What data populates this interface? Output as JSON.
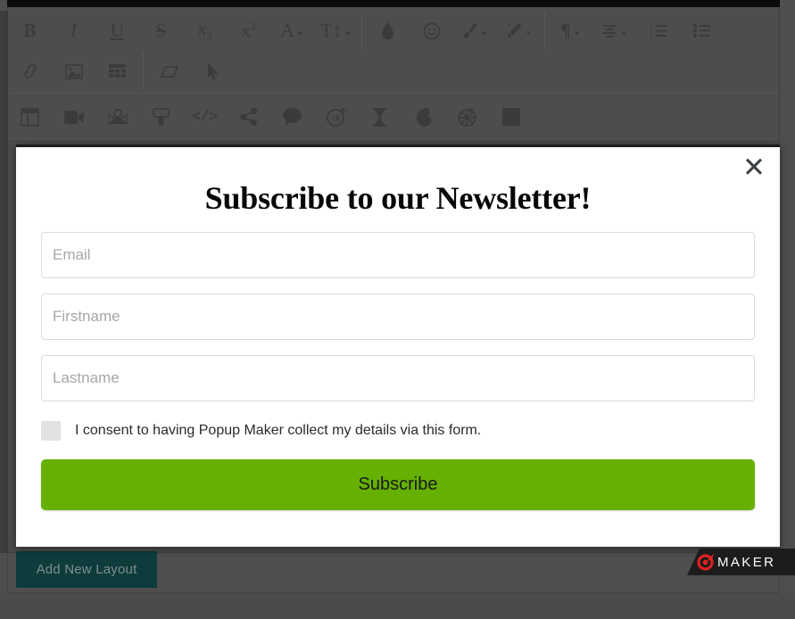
{
  "editor": {
    "toolbar_row1": [
      {
        "name": "bold-icon",
        "label": "B"
      },
      {
        "name": "italic-icon",
        "label": "I"
      },
      {
        "name": "underline-icon",
        "label": "U"
      },
      {
        "name": "strikethrough-icon",
        "label": "S"
      },
      {
        "name": "subscript-icon",
        "label": "x2"
      },
      {
        "name": "superscript-icon",
        "label": "x2"
      },
      {
        "name": "text-color-icon",
        "label": "A"
      },
      {
        "name": "font-size-icon",
        "label": "TI"
      },
      {
        "name": "highlight-color-icon",
        "label": "droplet"
      },
      {
        "name": "emoji-icon",
        "label": "smiley"
      },
      {
        "name": "paint-format-icon",
        "label": "brush"
      },
      {
        "name": "clear-format-icon",
        "label": "magic-wand"
      },
      {
        "name": "paragraph-icon",
        "label": "pilcrow"
      },
      {
        "name": "align-icon",
        "label": "align"
      },
      {
        "name": "ordered-list-icon",
        "label": "ordered-list"
      },
      {
        "name": "unordered-list-icon",
        "label": "unordered-list"
      }
    ],
    "toolbar_row2": [
      {
        "name": "link-icon",
        "label": "link"
      },
      {
        "name": "image-icon",
        "label": "image"
      },
      {
        "name": "table-icon",
        "label": "table"
      },
      {
        "name": "eraser-icon",
        "label": "eraser"
      },
      {
        "name": "cursor-icon",
        "label": "cursor"
      }
    ],
    "toolbar_row3": [
      {
        "name": "layout-icon",
        "label": "layout"
      },
      {
        "name": "video-icon",
        "label": "video"
      },
      {
        "name": "email-icon",
        "label": "email"
      },
      {
        "name": "tooltip-icon",
        "label": "tooltip"
      },
      {
        "name": "code-icon",
        "label": "</>"
      },
      {
        "name": "share-icon",
        "label": "share"
      },
      {
        "name": "message-icon",
        "label": "message"
      },
      {
        "name": "age-gate-icon",
        "label": "18+"
      },
      {
        "name": "countdown-icon",
        "label": "hourglass"
      },
      {
        "name": "mailchimp-icon",
        "label": "mailchimp"
      },
      {
        "name": "spin-wheel-icon",
        "label": "wheel"
      },
      {
        "name": "facebook-icon",
        "label": "facebook"
      }
    ],
    "add_layout_label": "Add New Layout"
  },
  "popup": {
    "close_label": "✕",
    "title": "Subscribe to our Newsletter!",
    "fields": [
      {
        "name": "email-field",
        "placeholder": "Email",
        "value": ""
      },
      {
        "name": "firstname-field",
        "placeholder": "Firstname",
        "value": ""
      },
      {
        "name": "lastname-field",
        "placeholder": "Lastname",
        "value": ""
      }
    ],
    "field_email_placeholder": "Email",
    "field_firstname_placeholder": "Firstname",
    "field_lastname_placeholder": "Lastname",
    "consent_text": "I consent to having Popup Maker collect my details via this form.",
    "consent_checked": false,
    "submit_label": "Subscribe"
  },
  "branding": {
    "maker_text": "MAKER",
    "logo_color": "#e02020"
  },
  "colors": {
    "accent_green": "#65b000",
    "teal_button": "#0e3b3b",
    "overlay_gray": "#4e4e4e",
    "badge_dark": "#1c1c1c"
  }
}
